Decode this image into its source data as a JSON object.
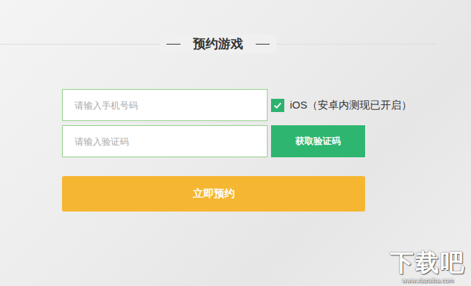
{
  "title": "预约游戏",
  "form": {
    "phone": {
      "placeholder": "请输入手机号码"
    },
    "platform": {
      "label": "iOS（安卓内测现已开启）",
      "checked": true
    },
    "code": {
      "placeholder": "请输入验证码"
    },
    "get_code_button": "获取验证码",
    "submit_button": "立即预约"
  },
  "watermark": {
    "logo": "下载吧",
    "url": "www.xiazaiba.com"
  }
}
